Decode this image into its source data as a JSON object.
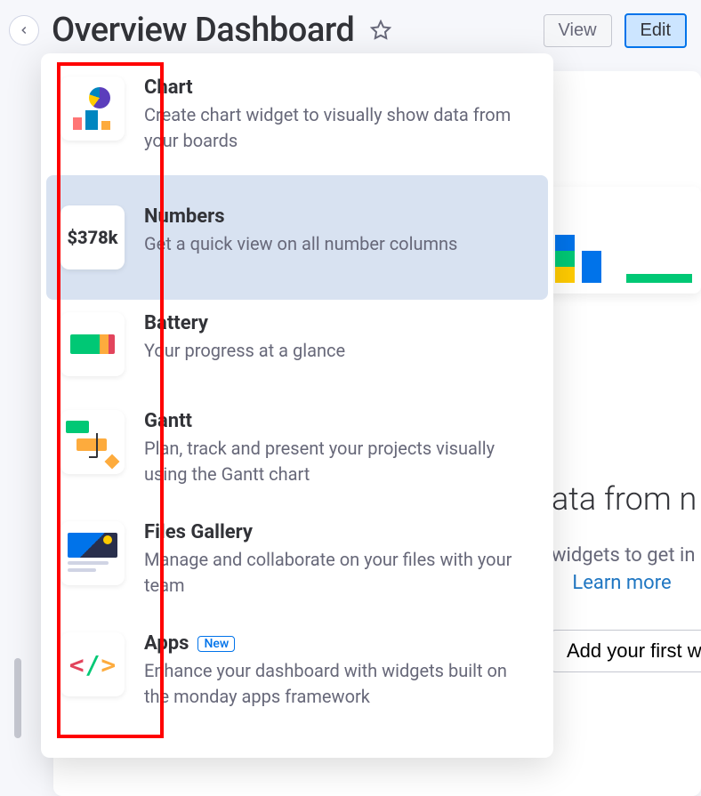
{
  "header": {
    "title": "Overview Dashboard",
    "view_label": "View",
    "edit_label": "Edit"
  },
  "widget_menu": {
    "items": [
      {
        "key": "chart",
        "title": "Chart",
        "desc": "Create chart widget to visually show data from your boards"
      },
      {
        "key": "numbers",
        "title": "Numbers",
        "desc": "Get a quick view on all number columns",
        "sample_value": "$378k",
        "selected": true
      },
      {
        "key": "battery",
        "title": "Battery",
        "desc": "Your progress at a glance"
      },
      {
        "key": "gantt",
        "title": "Gantt",
        "desc": "Plan, track and present your projects visually using the Gantt chart"
      },
      {
        "key": "files-gallery",
        "title": "Files Gallery",
        "desc": "Manage and collaborate on your files with your team"
      },
      {
        "key": "apps",
        "title": "Apps",
        "badge": "New",
        "desc": "Enhance your dashboard with widgets built on the monday apps framework"
      }
    ]
  },
  "background": {
    "heading_fragment": "ata from n",
    "subtext_fragment": "widgets to get in",
    "link_fragment": "Learn more",
    "cta_fragment": "Add your first w"
  }
}
